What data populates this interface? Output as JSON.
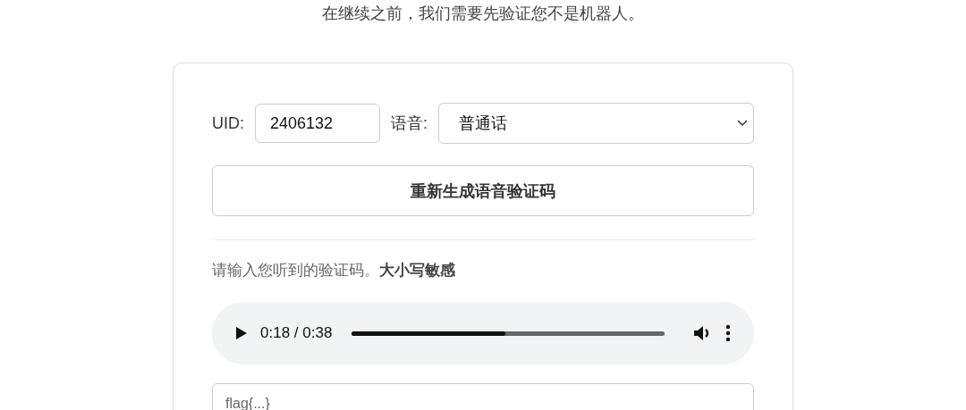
{
  "intro": "在继续之前，我们需要先验证您不是机器人。",
  "uid": {
    "label": "UID:",
    "value": "2406132"
  },
  "voice": {
    "label": "语音:",
    "value": "普通话"
  },
  "regenerate_button": "重新生成语音验证码",
  "hint": "请输入您听到的验证码。**大小写敏感**",
  "audio": {
    "time": "0:18 / 0:38",
    "level": 0.49
  },
  "answer": {
    "placeholder": "flag{...}"
  }
}
